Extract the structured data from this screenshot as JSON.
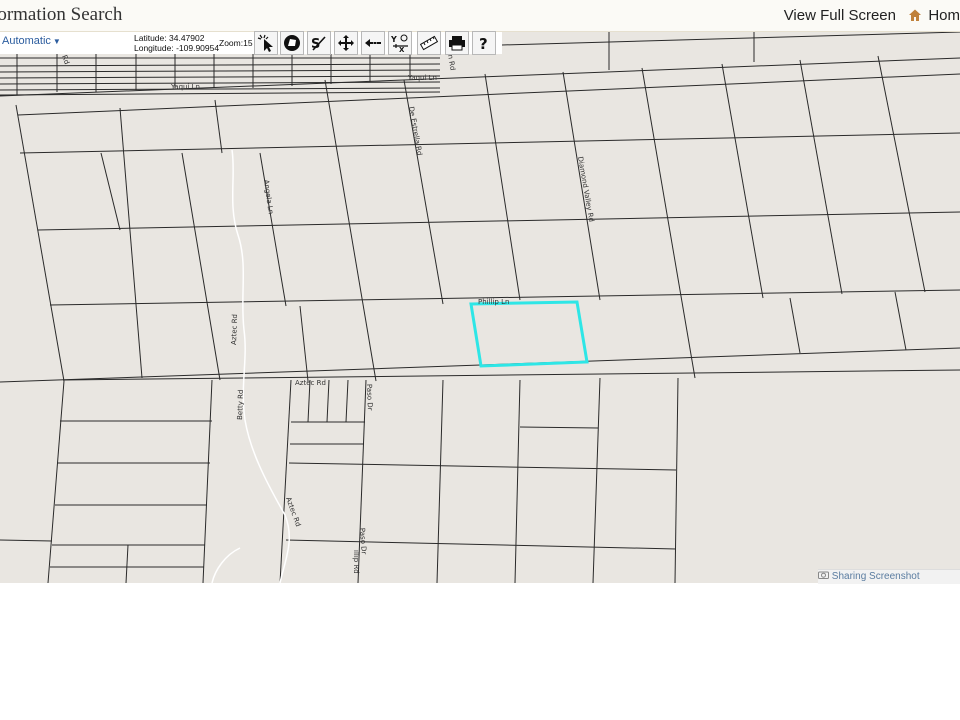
{
  "header": {
    "title": "formation Search",
    "view_full_screen": "View Full Screen",
    "home": "Hom"
  },
  "toolbar": {
    "basemap": "Automatic",
    "latitude_label": "Latitude:",
    "latitude": "34.47902",
    "longitude_label": "Longitude:",
    "longitude": "-109.90954",
    "zoom_label": "Zoom:",
    "zoom": "15",
    "tools": [
      "identify-icon",
      "polygon-select-icon",
      "measure-percent-icon",
      "pan-icon",
      "back-arrow-icon",
      "xy-locate-icon",
      "ruler-icon",
      "print-icon",
      "help-icon"
    ]
  },
  "map": {
    "road_labels": {
      "yaqui_ln": "Yaqui Ln",
      "yaqui_ln_2": "Yaqui Ln",
      "de_estrella_rd": "De Estrella Rd",
      "diamond_valley_rd": "Diamond Valley Rd",
      "angela_ln": "Angela Ln",
      "phillip_ln": "Phillip Ln",
      "aztec_rd_v": "Aztec Rd",
      "aztec_rd_h": "Aztec Rd",
      "betty_rd": "Betty Rd",
      "aztec_rd_diag": "Aztec Rd",
      "paso_dr": "Paso Dr",
      "paso_dr_2": "Paso Dr",
      "road_fragment_a": "Rd",
      "road_fragment_b": "n Rd",
      "phillip_rd_fragment": "illip Rd"
    },
    "highlight_color": "#2ee6e6",
    "background_color": "#e9e6e1"
  },
  "footer": {
    "sharing": "Sharing Screenshot"
  }
}
